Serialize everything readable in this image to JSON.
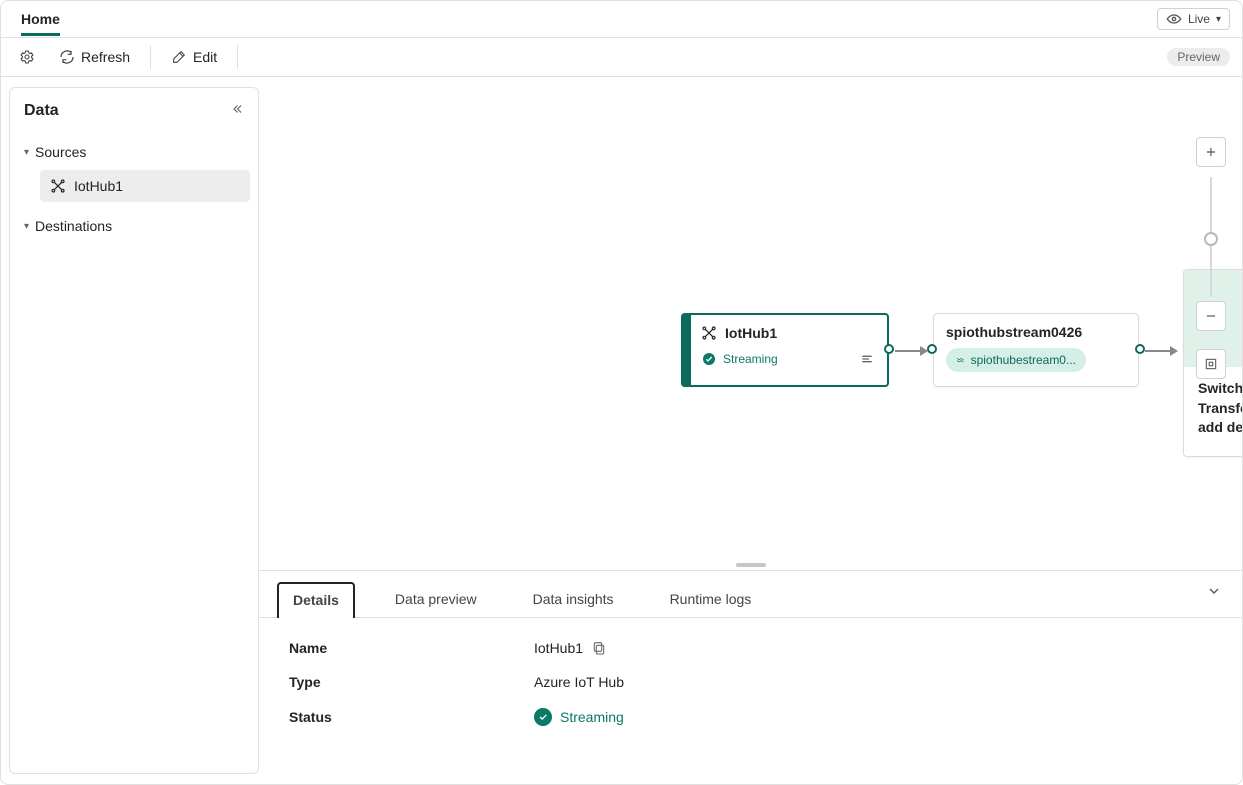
{
  "topnav": {
    "tabs": [
      {
        "label": "Home",
        "active": true
      }
    ],
    "liveLabel": "Live"
  },
  "toolbar": {
    "refreshLabel": "Refresh",
    "editLabel": "Edit",
    "previewLabel": "Preview"
  },
  "sidepanel": {
    "title": "Data",
    "sections": [
      {
        "label": "Sources",
        "items": [
          {
            "label": "IotHub1",
            "selected": true
          }
        ]
      },
      {
        "label": "Destinations",
        "items": []
      }
    ]
  },
  "canvas": {
    "sourceNode": {
      "title": "IotHub1",
      "statusLabel": "Streaming"
    },
    "streamNode": {
      "title": "spiothubstream0426",
      "chipLabel": "spiothubestream0..."
    },
    "placeholderNode": {
      "separator": "/",
      "message": "Switch to edit mode to Transform event or add destination"
    }
  },
  "bottomPanel": {
    "tabs": [
      {
        "label": "Details",
        "active": true
      },
      {
        "label": "Data preview",
        "active": false
      },
      {
        "label": "Data insights",
        "active": false
      },
      {
        "label": "Runtime logs",
        "active": false
      }
    ],
    "details": {
      "rows": [
        {
          "key": "Name",
          "value": "IotHub1",
          "copyable": true
        },
        {
          "key": "Type",
          "value": "Azure IoT Hub",
          "copyable": false
        },
        {
          "key": "Status",
          "value": "Streaming",
          "status": true
        }
      ]
    }
  }
}
